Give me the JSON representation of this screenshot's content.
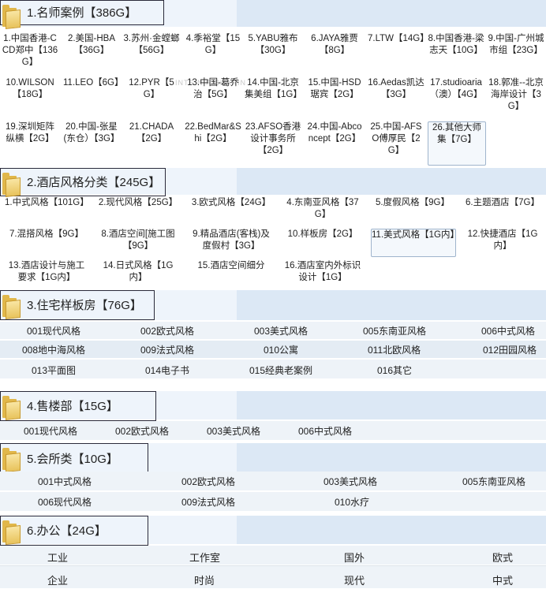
{
  "watermark": "INTE                 N R          SHARIN",
  "sections": [
    {
      "title": "1.名师案例【386G】"
    },
    {
      "title": "2.酒店风格分类【245G】"
    },
    {
      "title": "3.住宅样板房【76G】"
    },
    {
      "title": "4.售楼部【15G】"
    },
    {
      "title": "5.会所类【10G】"
    },
    {
      "title": "6.办公【24G】"
    }
  ],
  "s1": [
    "1.中国香港-CCD郑中【136G】",
    "2.美国-HBA【36G】",
    "3.苏州·金螳螂【56G】",
    "4.季裕堂【15G】",
    "5.YABU雅布【30G】",
    "6.JAYA雅贾【8G】",
    "7.LTW【14G】",
    "8.中国香港-梁志天【10G】",
    "9.中国-广州城市组【23G】",
    "10.WILSON【18G】",
    "11.LEO【6G】",
    "12.PYR【5G】",
    "13.中国-葛乔治【5G】",
    "14.中国-北京集美组【1G】",
    "15.中国-HSD琚宾【2G】",
    "16.Aedas凯达【3G】",
    "17.studioaria（澳）【4G】",
    "18.郭准--北京海岸设计【3G】",
    "19.深圳矩阵纵横【2G】",
    "20.中国-张星(东仓）【3G】",
    "21.CHADA【2G】",
    "22.BedMar&Shi【2G】",
    "23.AFSO香港设计事务所【2G】",
    "24.中国-Abconcept【2G】",
    "25.中国-AFSO傅厚民【2G】",
    "26.其他大师集【7G】"
  ],
  "s2": [
    "1.中式风格【101G】",
    "2.现代风格【25G】",
    "3.欧式风格【24G】",
    "4.东南亚风格【37G】",
    "5.度假风格【9G】",
    "6.主题酒店【7G】",
    "7.混搭风格【9G】",
    "8.酒店空间[施工图【9G】",
    "9.精品酒店(客栈)及度假村【3G】",
    "10.样板房【2G】",
    "11.美式风格【1G内】",
    "12.快捷酒店【1G内】",
    "13.酒店设计与施工要求【1G内】",
    "14.日式风格【1G内】",
    "15.酒店空间细分",
    "16.酒店室内外标识设计【1G】"
  ],
  "s3": [
    "001现代风格",
    "002欧式风格",
    "003美式风格",
    "005东南亚风格",
    "006中式风格",
    "008地中海风格",
    "009法式风格",
    "010公寓",
    "011北欧风格",
    "012田园风格",
    "013平面图",
    "014电子书",
    "015经典老案例",
    "016其它"
  ],
  "s4": [
    "001现代风格",
    "002欧式风格",
    "003美式风格",
    "006中式风格"
  ],
  "s5": [
    "001中式风格",
    "002欧式风格",
    "003美式风格",
    "005东南亚风格",
    "006现代风格",
    "009法式风格",
    "010水疗"
  ],
  "s6": [
    "工业",
    "工作室",
    "国外",
    "欧式",
    "企业",
    "时尚",
    "现代",
    "中式"
  ],
  "icons": {
    "folder": "folder-icon"
  },
  "colors": {
    "band": "#dce8f5",
    "accent": "#2a2a3a"
  }
}
